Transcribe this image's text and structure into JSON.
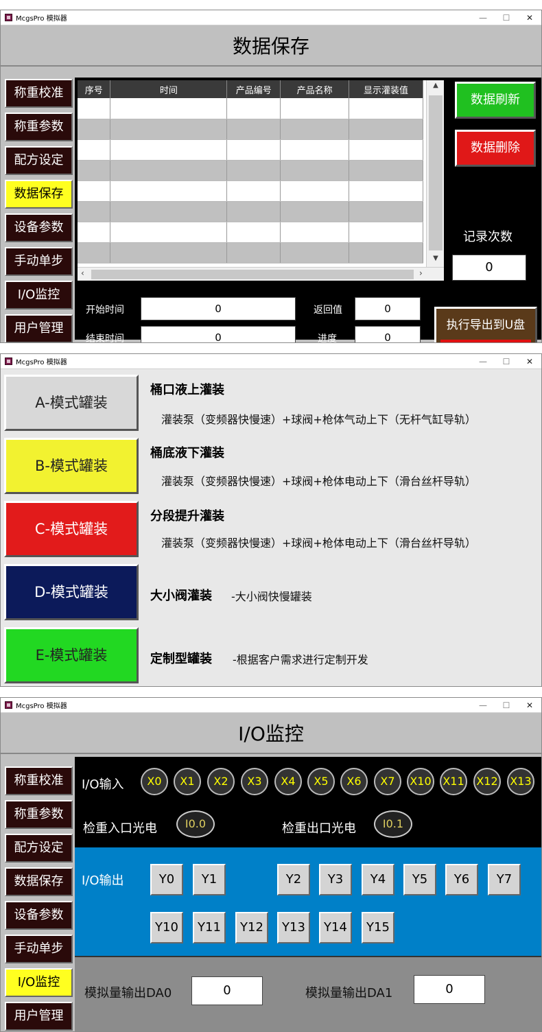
{
  "window1": {
    "title": "McgsPro 模拟器",
    "header": "数据保存",
    "sidebar": [
      "称重校准",
      "称重参数",
      "配方设定",
      "数据保存",
      "设备参数",
      "手动单步",
      "I/O监控",
      "用户管理"
    ],
    "columns": [
      "序号",
      "时间",
      "产品编号",
      "产品名称",
      "显示灌装值"
    ],
    "refresh_label": "数据刷新",
    "delete_label": "数据删除",
    "record_count_label": "记录次数",
    "record_count_value": "0",
    "start_time_label": "开始时间",
    "start_time_value": "0",
    "end_time_label": "结束时间",
    "end_time_value": "0",
    "return_label": "返回值",
    "return_value": "0",
    "progress_label": "进度",
    "progress_value": "0",
    "export_label": "执行导出到U盘"
  },
  "window2": {
    "title": "McgsPro 模拟器",
    "modes": [
      {
        "label": "A-模式罐装",
        "title": "桶口液上灌装",
        "desc": "灌装泵（变频器快慢速）+球阀+枪体气动上下（无杆气缸导轨）",
        "color": "#d8d8d8"
      },
      {
        "label": "B-模式罐装",
        "title": "桶底液下灌装",
        "desc": "灌装泵（变频器快慢速）+球阀+枪体电动上下（滑台丝杆导轨）",
        "color": "#f2f230"
      },
      {
        "label": "C-模式罐装",
        "title": "分段提升灌装",
        "desc": "灌装泵（变频器快慢速）+球阀+枪体电动上下（滑台丝杆导轨）",
        "color": "#e21b1b"
      },
      {
        "label": "D-模式罐装",
        "title": "大小阀灌装",
        "desc": "-大小阀快慢罐装",
        "color": "#0c1a5a"
      },
      {
        "label": "E-模式罐装",
        "title": "定制型罐装",
        "desc": "-根据客户需求进行定制开发",
        "color": "#22d822"
      }
    ]
  },
  "window3": {
    "title": "McgsPro 模拟器",
    "header": "I/O监控",
    "sidebar": [
      "称重校准",
      "称重参数",
      "配方设定",
      "数据保存",
      "设备参数",
      "手动单步",
      "I/O监控",
      "用户管理"
    ],
    "io_input_label": "I/O输入",
    "inputs": [
      "X0",
      "X1",
      "X2",
      "X3",
      "X4",
      "X5",
      "X6",
      "X7",
      "X10",
      "X11",
      "X12",
      "X13"
    ],
    "check_in_label": "检重入口光电",
    "check_in_value": "I0.0",
    "check_out_label": "检重出口光电",
    "check_out_value": "I0.1",
    "io_output_label": "I/O输出",
    "outputs_row1": [
      "Y0",
      "Y1",
      "Y2",
      "Y3",
      "Y4",
      "Y5",
      "Y6",
      "Y7"
    ],
    "outputs_row2": [
      "Y10",
      "Y11",
      "Y12",
      "Y13",
      "Y14",
      "Y15"
    ],
    "da0_label": "模拟量输出DA0",
    "da0_value": "0",
    "da1_label": "模拟量输出DA1",
    "da1_value": "0"
  }
}
